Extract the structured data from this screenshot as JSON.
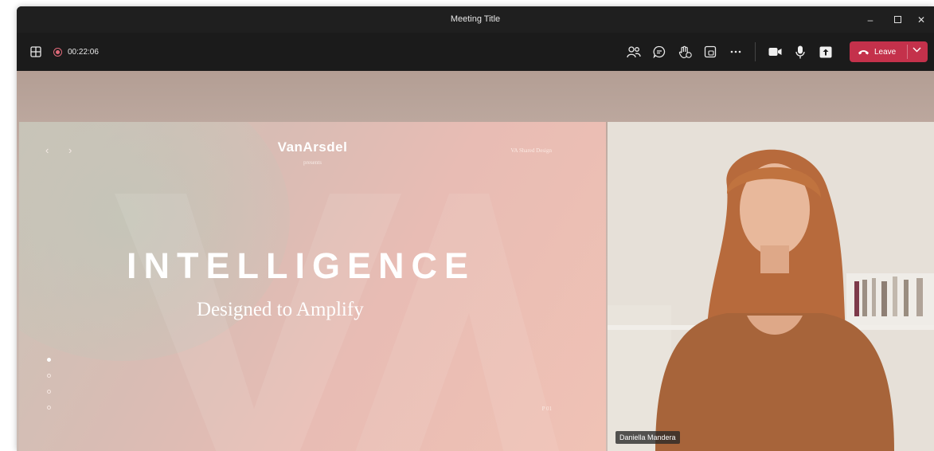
{
  "window": {
    "title": "Meeting Title"
  },
  "toolbar": {
    "timer": "00:22:06",
    "leave_label": "Leave",
    "icons": [
      "grid-icon",
      "recording-icon",
      "people-icon",
      "chat-icon",
      "raise-hand-icon",
      "share-tray-icon",
      "more-icon",
      "camera-icon",
      "mic-icon",
      "share-screen-icon",
      "phone-hangup-icon",
      "chevron-down-icon"
    ]
  },
  "slide": {
    "brand": "VanArsdel",
    "presents": "presents",
    "corner_label": "VA Shared Design",
    "headline": "INTELLIGENCE",
    "subheadline": "Designed to Amplify",
    "page_number": "P 01",
    "nav_prev": "‹",
    "nav_next": "›",
    "dots_total": 4,
    "dots_active": 1
  },
  "participant": {
    "name": "Daniella Mandera"
  },
  "colors": {
    "leave": "#c4314b",
    "titlebar": "#1f1f1f",
    "recording": "#e06a7a"
  }
}
